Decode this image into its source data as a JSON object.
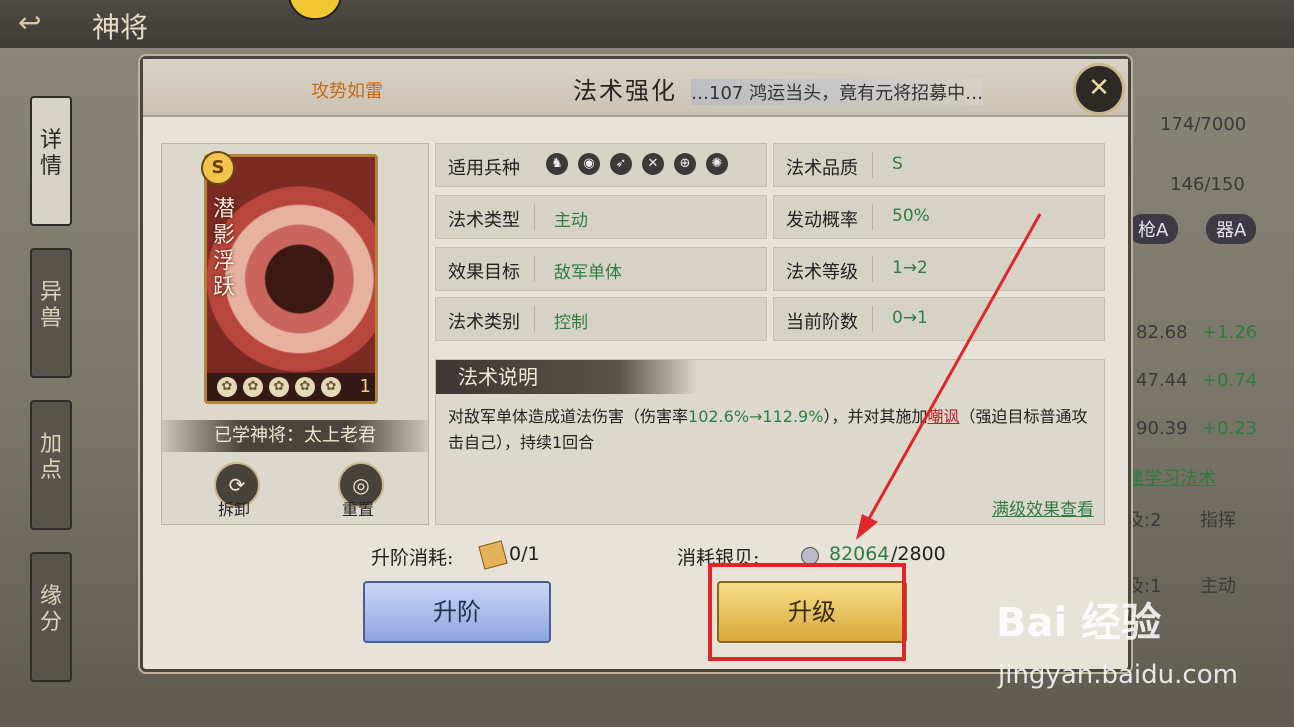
{
  "header": {
    "back_icon": "back-arrow-icon",
    "title": "神将"
  },
  "side_tabs": [
    {
      "label": "详情",
      "active": true
    },
    {
      "label": "异兽",
      "active": false
    },
    {
      "label": "加点",
      "active": false
    },
    {
      "label": "缘分",
      "active": false
    }
  ],
  "background_panel": {
    "progress_1": "174/7000",
    "progress_2": "146/150",
    "pill_1": "枪A",
    "pill_2": "器A",
    "stats": [
      {
        "value": "82.68",
        "delta": "+1.26"
      },
      {
        "value": "47.44",
        "delta": "+0.74"
      },
      {
        "value": "90.39",
        "delta": "+0.23"
      }
    ],
    "learn_link": "建学习法术",
    "table_cells": [
      "及:2",
      "指挥",
      "及:1",
      "主动"
    ]
  },
  "dialog": {
    "skill_tag": "攻势如雷",
    "title": "法术强化",
    "marquee": "…107 鸿运当头，竟有元将招募中…",
    "close_icon": "crossed-swords-close-icon",
    "card": {
      "grade": "S",
      "name": "潜影浮跃",
      "stars_count": 5,
      "level": "1"
    },
    "learned": "已学神将：太上老君",
    "dismantle_label": "拆卸",
    "reset_label": "重置",
    "info": [
      {
        "label": "适用兵种",
        "value": "",
        "icons": [
          "cavalry-icon",
          "shield-icon",
          "bow-icon",
          "swords-icon",
          "target-icon",
          "mage-icon"
        ]
      },
      {
        "label": "法术品质",
        "value": "S"
      },
      {
        "label": "法术类型",
        "value": "主动"
      },
      {
        "label": "发动概率",
        "value": "50%"
      },
      {
        "label": "效果目标",
        "value": "敌军单体"
      },
      {
        "label": "法术等级",
        "value": "1→2"
      },
      {
        "label": "法术类别",
        "value": "控制"
      },
      {
        "label": "当前阶数",
        "value": "0→1"
      }
    ],
    "description": {
      "header": "法术说明",
      "part1": "对敌军单体造成道法伤害（伤害率",
      "green": "102.6%→112.9%",
      "part2": "），并对其施加",
      "red": "嘲讽",
      "part3": "（强迫目标普通攻击自己），持续1回合",
      "link": "满级效果查看"
    },
    "advance_cost_label": "升阶消耗:",
    "advance_count": "0/1",
    "silver_label": "消耗银贝:",
    "silver_have": "82064",
    "silver_need": "/2800",
    "advance_button": "升阶",
    "upgrade_button": "升级"
  },
  "watermark": {
    "logo": "Bai 经验",
    "url": "jingyan.baidu.com"
  },
  "colors": {
    "accent_red": "#e0262b",
    "value_green": "#2f7d43",
    "gold": "#d8a93a"
  }
}
